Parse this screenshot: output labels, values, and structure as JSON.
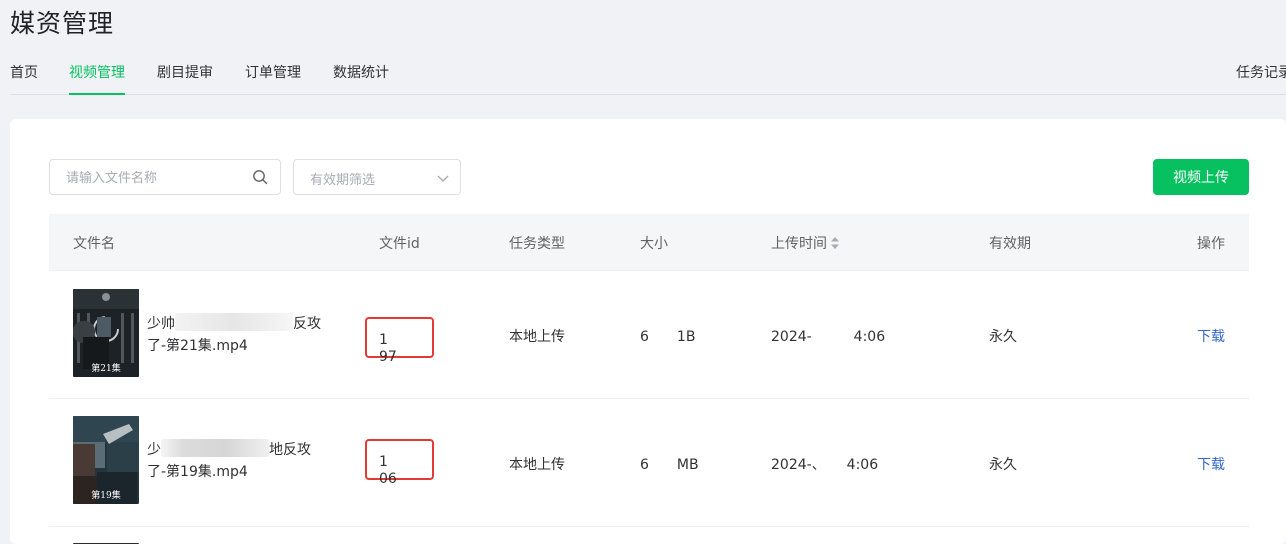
{
  "page": {
    "title": "媒资管理"
  },
  "nav": {
    "tabs": [
      {
        "label": "首页",
        "active": false
      },
      {
        "label": "视频管理",
        "active": true
      },
      {
        "label": "剧目提审",
        "active": false
      },
      {
        "label": "订单管理",
        "active": false
      },
      {
        "label": "数据统计",
        "active": false
      }
    ],
    "right_label": "任务记录"
  },
  "toolbar": {
    "search_placeholder": "请输入文件名称",
    "filter_placeholder": "有效期筛选",
    "upload_label": "视频上传"
  },
  "table": {
    "columns": [
      "文件名",
      "文件id",
      "任务类型",
      "大小",
      "上传时间",
      "有效期",
      "操作"
    ],
    "rows": [
      {
        "name_line1_start": "少帅",
        "name_line1_end": "反攻",
        "name_line2": "了-第21集.mp4",
        "thumb_caption": "第21集",
        "file_id": "1　　97",
        "task_type": "本地上传",
        "size": "6　　1B",
        "upload_time": "2024-　　　4:06",
        "validity": "永久",
        "action": "下载"
      },
      {
        "name_line1_start": "少",
        "name_line1_end": "地反攻",
        "name_line2": "了-第19集.mp4",
        "thumb_caption": "第19集",
        "file_id": "1　　06",
        "task_type": "本地上传",
        "size": "6　　MB",
        "upload_time": "2024-、　　4:06",
        "validity": "永久",
        "action": "下载"
      }
    ]
  },
  "colors": {
    "accent": "#07c160",
    "highlight_box": "#e53935",
    "link": "#3366cc"
  }
}
